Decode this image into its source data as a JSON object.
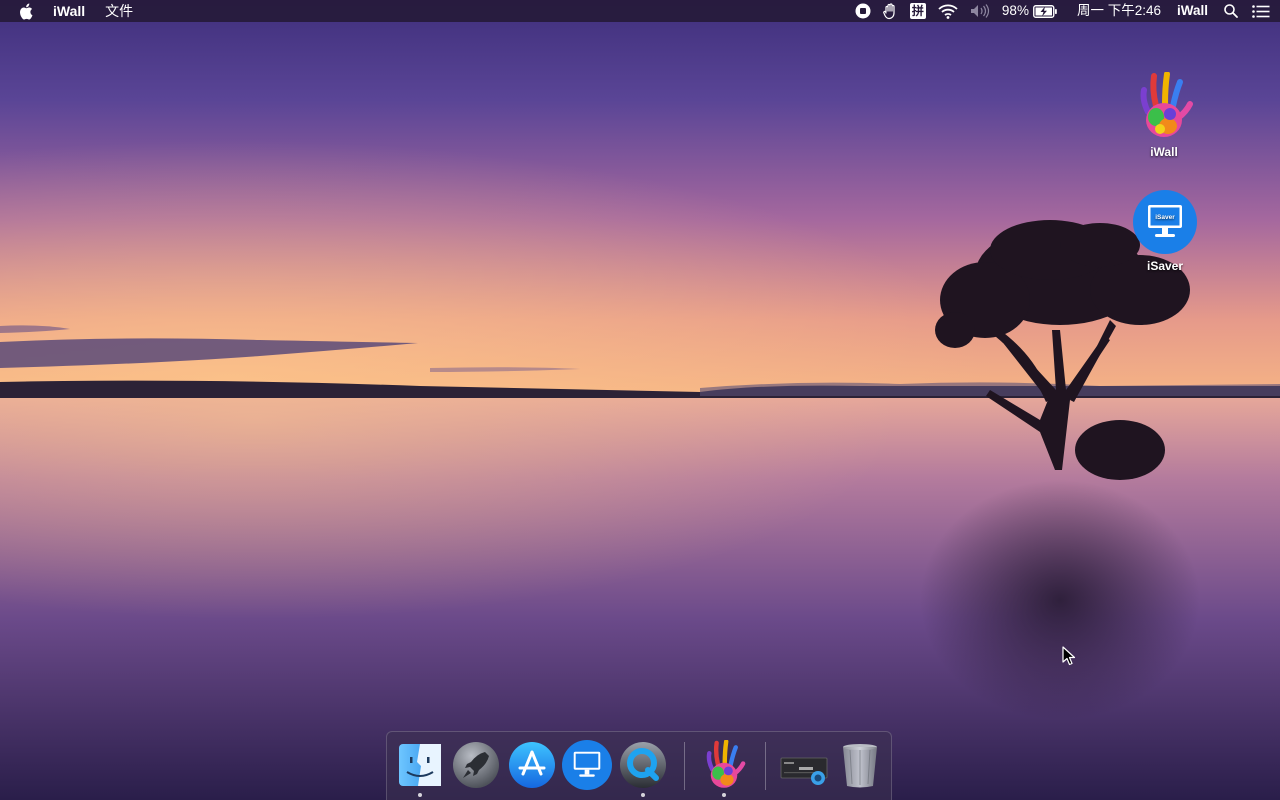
{
  "menubar": {
    "left": {
      "app_name": "iWall",
      "menu_file": "文件"
    },
    "right": {
      "battery_percent": "98%",
      "clock": "周一 下午2:46",
      "app_name": "iWall",
      "input_method_glyph": "拼"
    }
  },
  "desktop_icons": [
    {
      "label": "iWall",
      "icon": "handprint-icon"
    },
    {
      "label": "iSaver",
      "icon": "isaver-monitor-icon"
    }
  ],
  "isaver_badge_text": "iSaver",
  "dock": {
    "items": [
      {
        "name": "Finder",
        "icon": "finder-icon",
        "running": true
      },
      {
        "name": "Launchpad",
        "icon": "launchpad-rocket-icon",
        "running": false
      },
      {
        "name": "App Store",
        "icon": "app-store-icon",
        "running": false
      },
      {
        "name": "iSaver",
        "icon": "isaver-monitor-icon",
        "running": false
      },
      {
        "name": "QuickTime Player",
        "icon": "quicktime-icon",
        "running": true
      },
      {
        "name": "iWall",
        "icon": "handprint-icon",
        "running": true
      },
      {
        "name": "Screen Capture",
        "icon": "screen-thumbnail-icon",
        "running": false
      },
      {
        "name": "Trash",
        "icon": "trash-icon",
        "running": false
      }
    ]
  },
  "colors": {
    "isaver_blue": "#1a7fe8",
    "menubar_bg": "#261a3a",
    "sky_top": "#4a3585",
    "horizon": "#f0a070"
  }
}
